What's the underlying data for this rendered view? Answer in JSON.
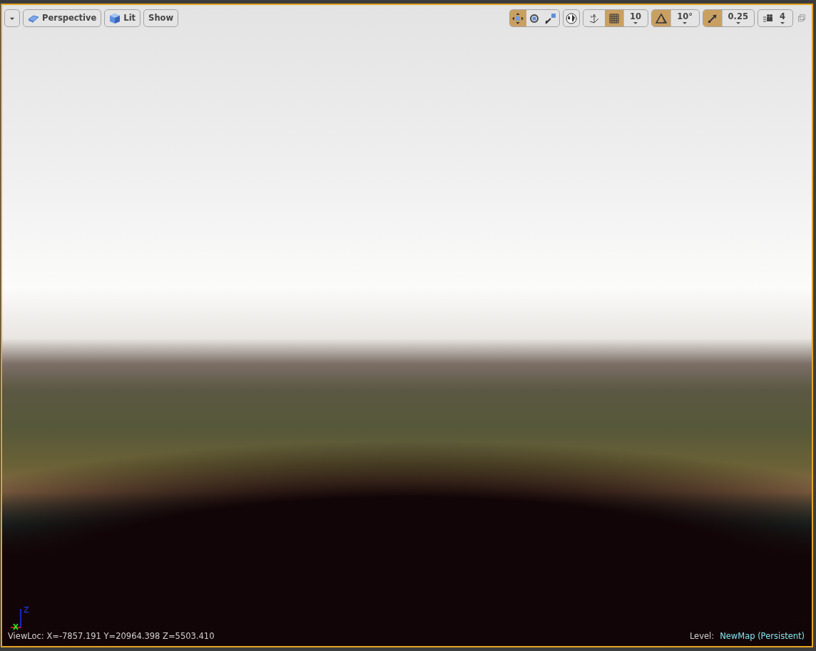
{
  "view_buttons": [
    {
      "kind": "perspective",
      "label": "Perspective"
    },
    {
      "kind": "lit",
      "label": "Lit"
    },
    {
      "kind": "plain",
      "label": "Show"
    }
  ],
  "transform_tools": [
    {
      "kind": "translate",
      "selected": true
    },
    {
      "kind": "rotate",
      "selected": false
    },
    {
      "kind": "scale",
      "selected": false
    }
  ],
  "surface_snap": {
    "on": false
  },
  "snapping": [
    {
      "kind": "grid",
      "on": true,
      "value": "10"
    },
    {
      "kind": "rotation",
      "on": true,
      "value": "10°"
    },
    {
      "kind": "scale",
      "on": true,
      "value": "0.25"
    }
  ],
  "camera_speed": "4",
  "axis_label": "Z",
  "view_location": "ViewLoc: X=-7857.191 Y=20964.398 Z=5503.410",
  "level": {
    "label": "Level:",
    "name": "NewMap (Persistent)"
  }
}
